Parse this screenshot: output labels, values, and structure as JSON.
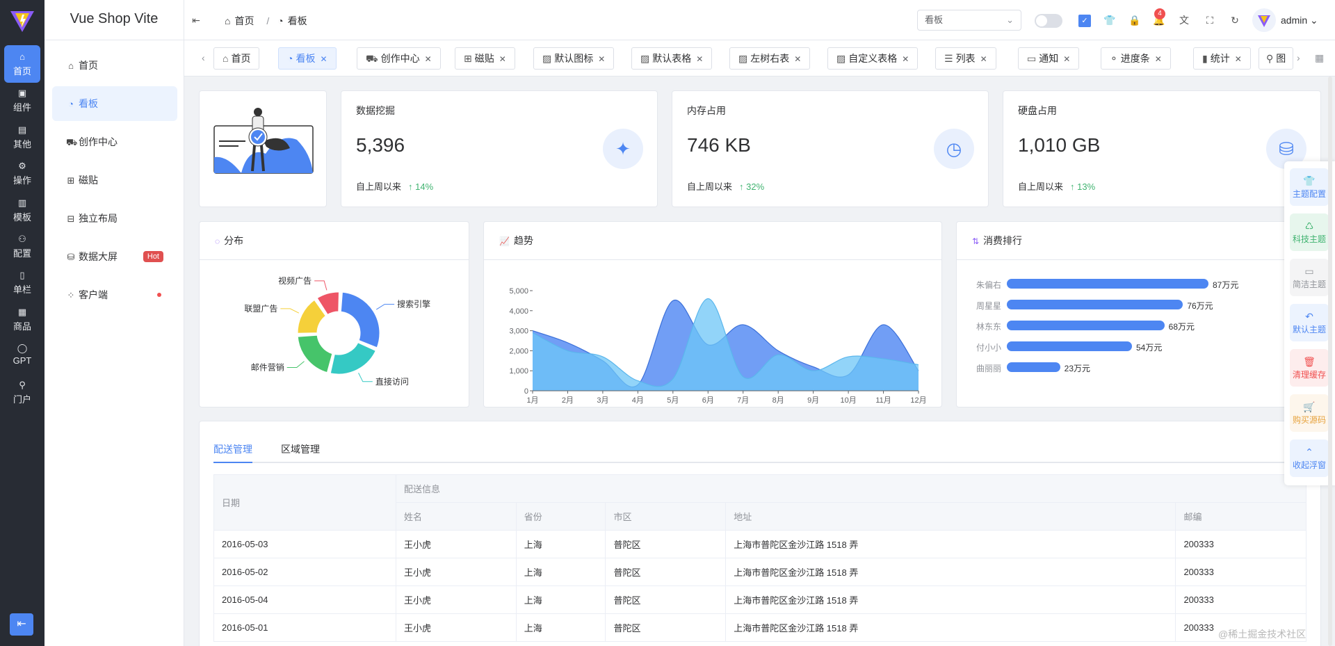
{
  "app": {
    "brand": "Vue Shop Vite"
  },
  "rail": [
    {
      "label": "首页",
      "icon": "home-icon",
      "active": true
    },
    {
      "label": "组件",
      "icon": "component-icon"
    },
    {
      "label": "其他",
      "icon": "box-icon"
    },
    {
      "label": "操作",
      "icon": "operation-icon"
    },
    {
      "label": "模板",
      "icon": "template-icon"
    },
    {
      "label": "配置",
      "icon": "config-icon"
    },
    {
      "label": "单栏",
      "icon": "column-icon"
    },
    {
      "label": "商品",
      "icon": "goods-icon"
    },
    {
      "label": "GPT",
      "icon": "chat-icon"
    },
    {
      "label": "门户",
      "icon": "portal-icon"
    }
  ],
  "menu": [
    {
      "label": "首页",
      "icon": "home-icon"
    },
    {
      "label": "看板",
      "icon": "dashboard-icon",
      "active": true
    },
    {
      "label": "创作中心",
      "icon": "car-icon"
    },
    {
      "label": "磁贴",
      "icon": "tile-icon"
    },
    {
      "label": "独立布局",
      "icon": "layout-icon"
    },
    {
      "label": "数据大屏",
      "icon": "database-icon",
      "badge": "Hot"
    },
    {
      "label": "客户端",
      "icon": "client-icon",
      "dot": true
    }
  ],
  "header": {
    "breadcrumb": [
      "首页",
      "看板"
    ],
    "select_value": "看板",
    "toggle_label": "",
    "notification_count": "4",
    "user": "admin"
  },
  "tabs": [
    {
      "label": "首页",
      "icon": "home-icon",
      "closable": false
    },
    {
      "label": "看板",
      "icon": "dashboard-icon",
      "active": true,
      "closable": true
    },
    {
      "label": "创作中心",
      "icon": "car-icon",
      "closable": true
    },
    {
      "label": "磁贴",
      "icon": "tile-icon",
      "closable": true
    },
    {
      "label": "默认图标",
      "icon": "image-icon",
      "closable": true
    },
    {
      "label": "默认表格",
      "icon": "image-icon",
      "closable": true
    },
    {
      "label": "左树右表",
      "icon": "image-icon",
      "closable": true
    },
    {
      "label": "自定义表格",
      "icon": "image-icon",
      "closable": true
    },
    {
      "label": "列表",
      "icon": "list-icon",
      "closable": true
    },
    {
      "label": "通知",
      "icon": "message-icon",
      "closable": true
    },
    {
      "label": "进度条",
      "icon": "progress-icon",
      "closable": true
    },
    {
      "label": "统计",
      "icon": "bar-chart-icon",
      "closable": true
    }
  ],
  "stats": [
    {
      "title": "数据挖掘",
      "value": "5,396",
      "foot": "自上周以来",
      "change": "14%",
      "icon": "sparkle-icon"
    },
    {
      "title": "内存占用",
      "value": "746 KB",
      "foot": "自上周以来",
      "change": "32%",
      "icon": "gauge-icon"
    },
    {
      "title": "硬盘占用",
      "value": "1,010 GB",
      "foot": "自上周以来",
      "change": "13%",
      "icon": "usb-icon"
    }
  ],
  "panels": {
    "distribution": "分布",
    "trend": "趋势",
    "ranking": "消费排行"
  },
  "chart_data": [
    {
      "type": "pie",
      "title": "分布",
      "categories": [
        "搜索引擎",
        "直接访问",
        "邮件营销",
        "联盟广告",
        "视频广告"
      ],
      "values": [
        30,
        22,
        20,
        16,
        10
      ],
      "colors": [
        "#4d86f2",
        "#35c9c4",
        "#46c46a",
        "#f5d03a",
        "#ee5566"
      ]
    },
    {
      "type": "area",
      "title": "趋势",
      "categories": [
        "1月",
        "2月",
        "3月",
        "4月",
        "5月",
        "6月",
        "7月",
        "8月",
        "9月",
        "10月",
        "11月",
        "12月"
      ],
      "yticks": [
        "0",
        "1,000",
        "2,000",
        "3,000",
        "4,000",
        "5,000"
      ],
      "ylim": [
        0,
        5000
      ],
      "series": [
        {
          "values": [
            3000,
            2400,
            1500,
            300,
            4500,
            2300,
            3300,
            2000,
            1200,
            800,
            3300,
            1000
          ],
          "color": "#4d86f2"
        },
        {
          "values": [
            2900,
            2000,
            1700,
            500,
            600,
            4600,
            700,
            1800,
            1000,
            1700,
            1600,
            1300
          ],
          "color": "#6ec5f7"
        }
      ]
    },
    {
      "type": "bar",
      "title": "消费排行",
      "categories": [
        "朱偏右",
        "周星星",
        "林东东",
        "付小小",
        "曲丽丽"
      ],
      "values": [
        87,
        76,
        68,
        54,
        23
      ],
      "labels": [
        "87万元",
        "76万元",
        "68万元",
        "54万元",
        "23万元"
      ],
      "xlim": [
        0,
        87
      ]
    }
  ],
  "table": {
    "tabs": [
      "配送管理",
      "区域管理"
    ],
    "group_header": "配送信息",
    "date_header": "日期",
    "columns": [
      "姓名",
      "省份",
      "市区",
      "地址",
      "邮编"
    ],
    "rows": [
      [
        "2016-05-03",
        "王小虎",
        "上海",
        "普陀区",
        "上海市普陀区金沙江路 1518 弄",
        "200333"
      ],
      [
        "2016-05-02",
        "王小虎",
        "上海",
        "普陀区",
        "上海市普陀区金沙江路 1518 弄",
        "200333"
      ],
      [
        "2016-05-04",
        "王小虎",
        "上海",
        "普陀区",
        "上海市普陀区金沙江路 1518 弄",
        "200333"
      ],
      [
        "2016-05-01",
        "王小虎",
        "上海",
        "普陀区",
        "上海市普陀区金沙江路 1518 弄",
        "200333"
      ]
    ]
  },
  "float": [
    {
      "label": "主题配置",
      "color": "#4d86f2",
      "bg": "#ecf3fe",
      "icon": "shirt-icon"
    },
    {
      "label": "科技主题",
      "color": "#40b370",
      "bg": "#e7f6ed",
      "icon": "tech-icon"
    },
    {
      "label": "简洁主题",
      "color": "#909399",
      "bg": "#f4f4f5",
      "icon": "monitor-icon"
    },
    {
      "label": "默认主题",
      "color": "#4d86f2",
      "bg": "#ecf3fe",
      "icon": "undo-icon"
    },
    {
      "label": "清理缓存",
      "color": "#f05050",
      "bg": "#fdeded",
      "icon": "trash-icon"
    },
    {
      "label": "购买源码",
      "color": "#e6a23c",
      "bg": "#fdf6ec",
      "icon": "cart-icon"
    },
    {
      "label": "收起浮窗",
      "color": "#4d86f2",
      "bg": "#ecf3fe",
      "icon": "collapse-up-icon"
    }
  ],
  "watermark": "@稀土掘金技术社区"
}
